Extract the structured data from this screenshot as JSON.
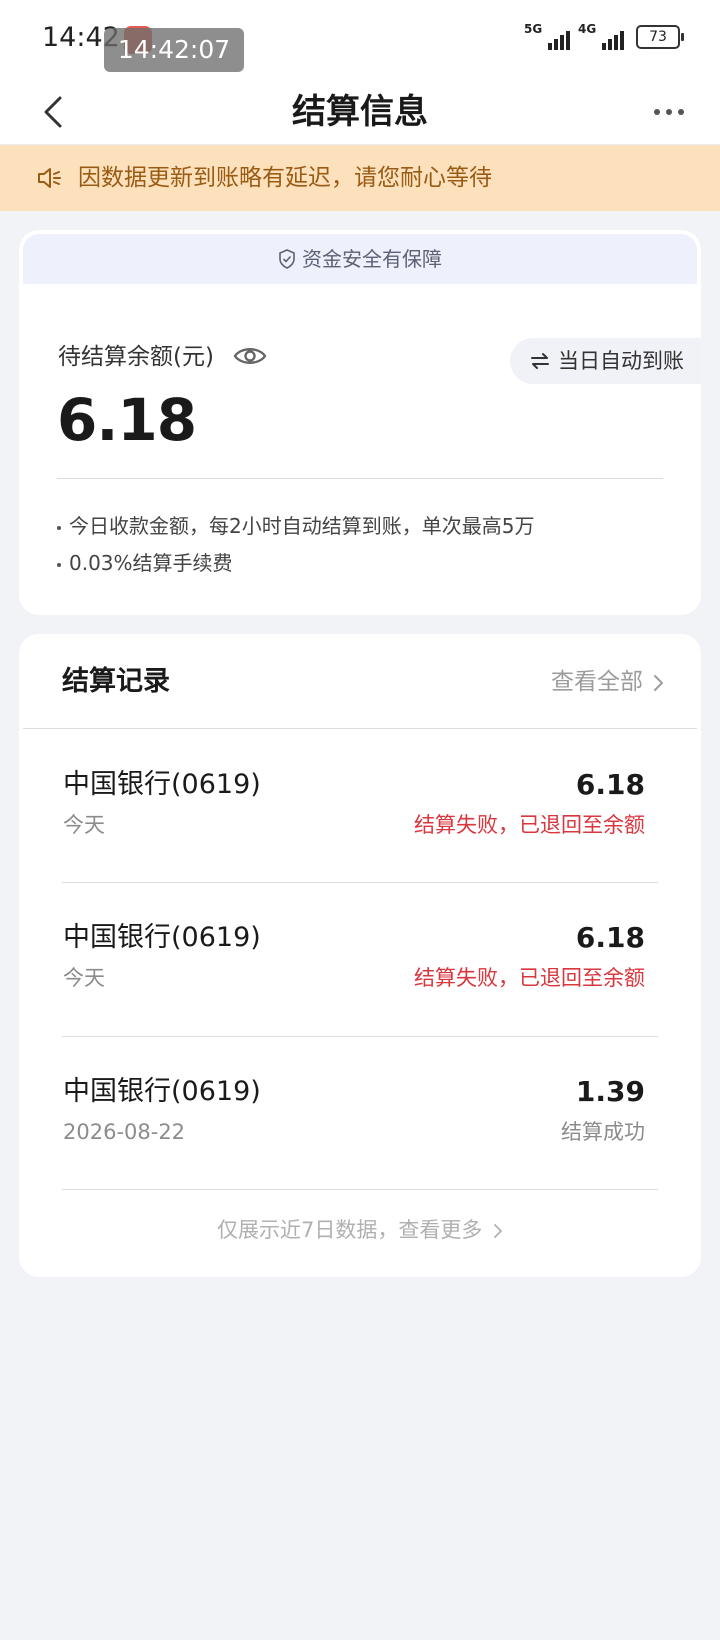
{
  "status_bar": {
    "time": "14:42",
    "time_overlay": "14:42:07",
    "network_1": "5G",
    "network_2": "4G",
    "battery": "73"
  },
  "nav": {
    "title": "结算信息"
  },
  "notice": {
    "text": "因数据更新到账略有延迟，请您耐心等待",
    "background_color": "#fde1bd",
    "text_color": "#9a5b14"
  },
  "balance_card": {
    "safety_text": "资金安全有保障",
    "label": "待结算余额(元)",
    "auto_label": "当日自动到账",
    "amount": "6.18",
    "rules": [
      "今日收款金额，每2小时自动结算到账，单次最高5万",
      "0.03%结算手续费"
    ]
  },
  "records": {
    "title": "结算记录",
    "view_all": "查看全部",
    "items": [
      {
        "bank": "中国银行(0619)",
        "date": "今天",
        "amount": "6.18",
        "status": "结算失败，已退回至余额",
        "status_color": "#d9363e"
      },
      {
        "bank": "中国银行(0619)",
        "date": "今天",
        "amount": "6.18",
        "status": "结算失败，已退回至余额",
        "status_color": "#d9363e"
      },
      {
        "bank": "中国银行(0619)",
        "date": "2026-08-22",
        "amount": "1.39",
        "status": "结算成功",
        "status_color": "#8c8c8c"
      }
    ],
    "footer": "仅展示近7日数据，查看更多"
  },
  "icons": {
    "back": "chevron-left-icon",
    "more": "more-dots-icon",
    "notice": "speaker-icon",
    "safety": "shield-check-icon",
    "visibility": "eye-icon",
    "auto": "swap-arrows-icon",
    "view_all": "chevron-right-icon"
  }
}
